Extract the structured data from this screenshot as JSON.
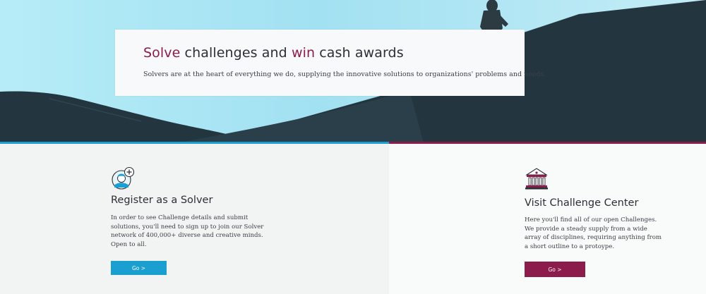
{
  "hero": {
    "title_parts": [
      {
        "text": "Solve",
        "accent": true
      },
      {
        "text": " challenges and ",
        "accent": false
      },
      {
        "text": "win",
        "accent": true
      },
      {
        "text": " cash awards",
        "accent": false
      }
    ],
    "subtitle": "Solvers are at the heart of everything we do, supplying the innovative solutions to organizations' problems and needs."
  },
  "register": {
    "icon": "solver-avatar-plus-icon",
    "title": "Register as a Solver",
    "body": "In order to see Challenge details and submit\nsolutions, you'll need to sign up to join our Solver\nnetwork of 400,000+ diverse and creative minds.\nOpen to all.",
    "button_label": "Go >"
  },
  "challenge_center": {
    "icon": "bank-building-icon",
    "title": "Visit Challenge Center",
    "body": "Here you'll find all of our open Challenges.\nWe provide a steady supply from a wide\narray of disciplines, requiring anything from\na short outline to a protoype.",
    "button_label": "Go >"
  },
  "colors": {
    "accent_purple": "#8b1c4c",
    "accent_blue": "#1b9fd0",
    "mountain": "#233640",
    "sky": "#a9e3f2"
  }
}
